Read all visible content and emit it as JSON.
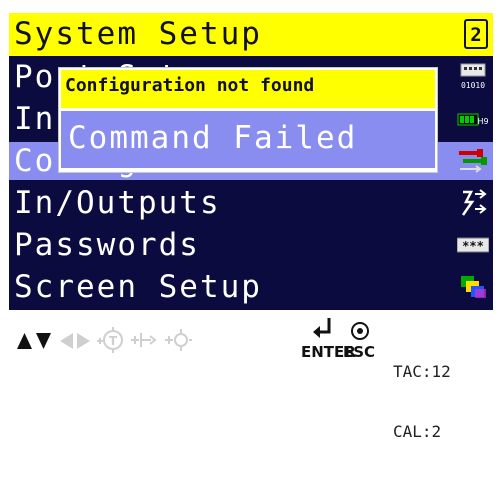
{
  "header": {
    "title": "System Setup",
    "page_badge": "2"
  },
  "menu": {
    "items": [
      {
        "label": "Port Setup",
        "icon": "port-io-icon"
      },
      {
        "label": "In",
        "icon": "battery-level-icon"
      },
      {
        "label": "Configuration",
        "icon": "wrench-settings-icon",
        "selected": true
      },
      {
        "label": "In/Outputs",
        "icon": "in-outputs-icon"
      },
      {
        "label": "Passwords",
        "icon": "password-icon"
      },
      {
        "label": "Screen Setup",
        "icon": "screen-layers-icon"
      }
    ]
  },
  "dialog": {
    "title": "Configuration not found",
    "message": "Command Failed"
  },
  "footer": {
    "enter_label": "ENTER",
    "esc_label": "ESC",
    "tac": "TAC:12",
    "cal": "CAL:2",
    "icons": [
      "up-arrow-icon",
      "down-arrow-icon",
      "left-arrow-icon",
      "right-arrow-icon",
      "tare-icon",
      "zero-plus-icon",
      "gross-zero-icon",
      "enter-icon",
      "esc-icon"
    ]
  },
  "colors": {
    "title_bg": "#ffff00",
    "menu_bg": "#0b0b40",
    "selected_bg": "#8a8df0",
    "text": "#ffffff"
  }
}
